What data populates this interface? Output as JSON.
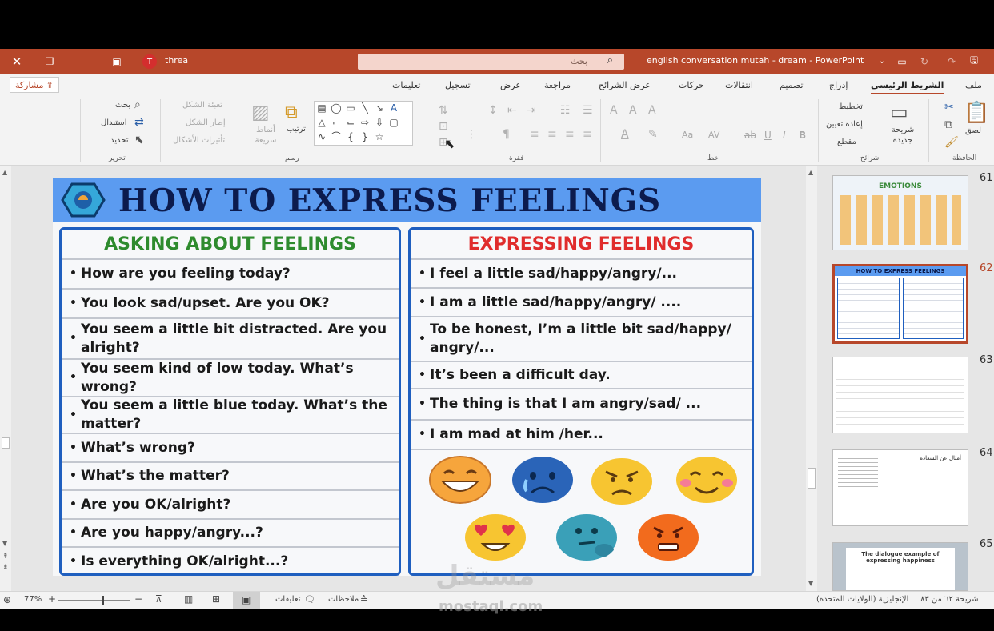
{
  "titlebar": {
    "user_initial": "T",
    "user_name": "threa",
    "search_placeholder": "بحث",
    "doc_title": "english conversation mutah - dream  -  PowerPoint",
    "accent": "#b7472a"
  },
  "ribbon": {
    "tabs": [
      "ملف",
      "الشريط الرئيسي",
      "إدراج",
      "تصميم",
      "انتقالات",
      "حركات",
      "عرض الشرائح",
      "مراجعة",
      "عرض",
      "تسجيل",
      "تعليمات"
    ],
    "active_tab": "الشريط الرئيسي",
    "share": "مشاركة",
    "clipboard": {
      "paste": "لصق",
      "group": "الحافظة"
    },
    "slides": {
      "new_slide": "شريحة جديدة",
      "layout": "تخطيط",
      "reset": "إعادة تعيين",
      "section": "مقطع",
      "group": "شرائح"
    },
    "font": {
      "group": "خط",
      "bold": "B",
      "italic": "I",
      "underline": "U",
      "strike": "ab",
      "spacing": "AV",
      "case": "Aa"
    },
    "paragraph": {
      "group": "فقرة"
    },
    "drawing": {
      "arrange": "ترتيب",
      "quick_styles": "أنماط سريعة",
      "shape_fill": "تعبئة الشكل",
      "shape_outline": "إطار الشكل",
      "shape_effects": "تأثيرات الأشكال",
      "group": "رسم"
    },
    "editing": {
      "find": "بحث",
      "replace": "استبدال",
      "select": "تحديد",
      "group": "تحرير"
    }
  },
  "slide": {
    "title": "HOW TO EXPRESS FEELINGS",
    "left_heading": "ASKING ABOUT FEELINGS",
    "right_heading": "EXPRESSING FEELINGS",
    "left_items": [
      "How are you feeling today?",
      "You look sad/upset. Are you OK?",
      "You seem a little bit distracted. Are you alright?",
      "You seem kind of low today. What’s wrong?",
      "You seem a little blue today. What’s the matter?",
      "What’s wrong?",
      "What’s the matter?",
      "Are you OK/alright?",
      "Are you happy/angry...?",
      "Is everything OK/alright...?"
    ],
    "right_items": [
      "I feel a little sad/happy/angry/...",
      "I am a little sad/happy/angry/ ....",
      "To be honest, I’m a little bit sad/happy/ angry/...",
      "It’s been a difficult day.",
      "The thing is that I am angry/sad/ ...",
      "I am mad at him /her..."
    ],
    "emoji_names": [
      "laughing-face-icon",
      "crying-face-icon",
      "angry-face-icon",
      "smiling-face-icon",
      "heart-eyes-face-icon",
      "thinking-face-icon",
      "frustrated-face-icon"
    ]
  },
  "thumbnails": [
    {
      "number": "61",
      "caption": "EMOTIONS"
    },
    {
      "number": "62",
      "caption": "HOW TO EXPRESS FEELINGS"
    },
    {
      "number": "63",
      "caption": ""
    },
    {
      "number": "64",
      "caption": "أمثال عن السعادة"
    },
    {
      "number": "65",
      "caption": "The dialogue example of expressing happiness"
    }
  ],
  "statusbar": {
    "slide_counter": "شريحة ٦٢ من ٨٣",
    "language": "الإنجليزية (الولايات المتحدة)",
    "notes": "ملاحظات",
    "comments": "تعليقات",
    "zoom": "77%"
  },
  "watermark": {
    "arabic": "مستقل",
    "latin": "mostaql.com"
  }
}
